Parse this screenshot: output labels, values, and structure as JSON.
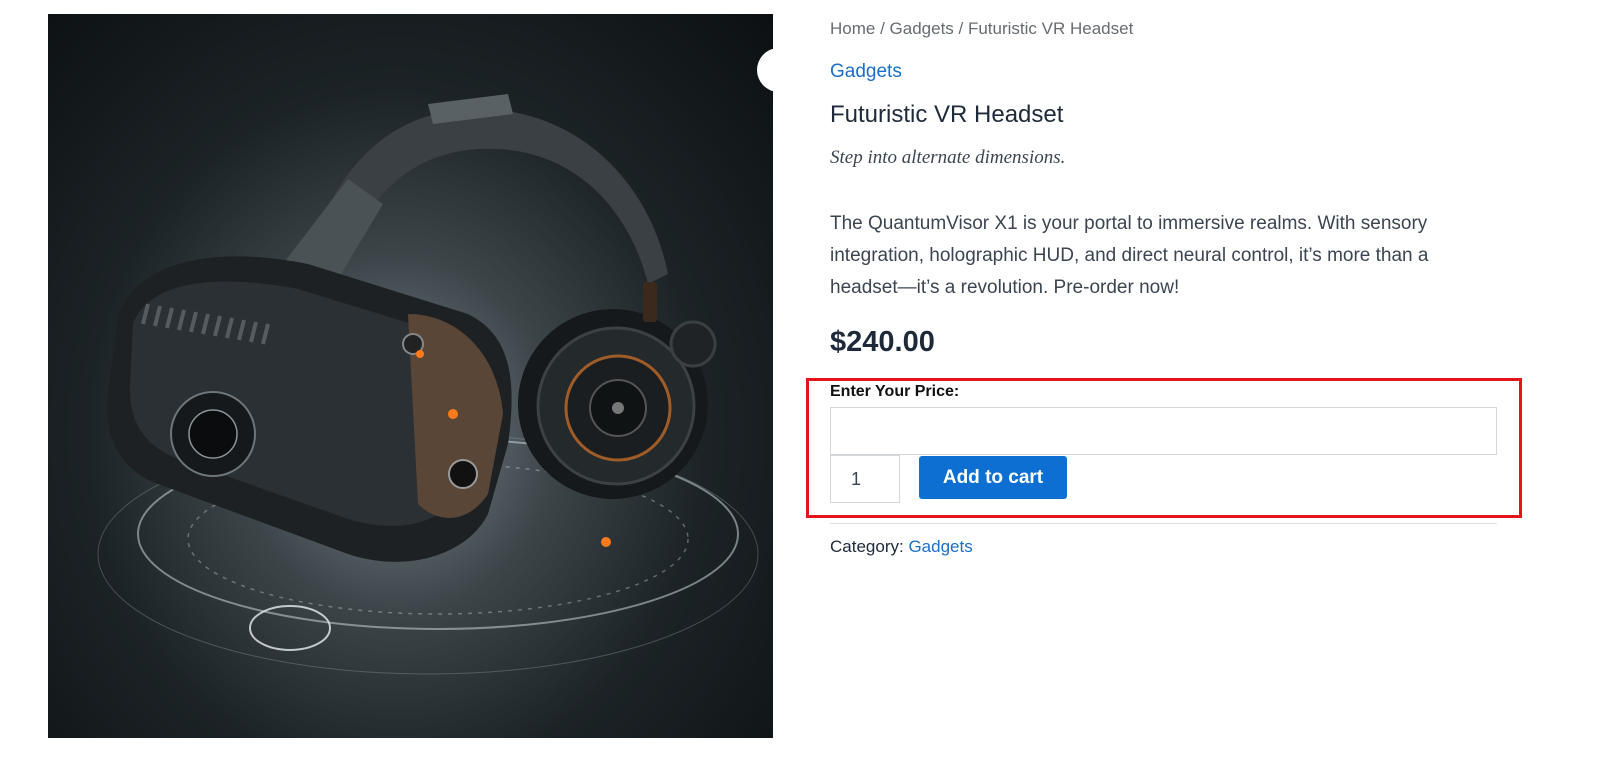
{
  "breadcrumb": {
    "home": "Home",
    "sep1": " / ",
    "category": "Gadgets",
    "sep2": " / ",
    "current": "Futuristic VR Headset"
  },
  "product": {
    "category_link": "Gadgets",
    "title": "Futuristic VR Headset",
    "tagline": "Step into alternate dimensions.",
    "description": "The QuantumVisor X1 is your portal to immersive realms. With sensory integration, holographic HUD, and direct neural control, it’s more than a headset—it’s a revolution. Pre-order now!",
    "price": "$240.00"
  },
  "form": {
    "price_label": "Enter Your Price:",
    "price_value": "",
    "quantity": "1",
    "add_to_cart_label": "Add to cart"
  },
  "meta": {
    "category_label": "Category:",
    "category_value": "Gadgets"
  },
  "icons": {
    "zoom": "magnifier-icon"
  },
  "colors": {
    "link": "#1a6fc9",
    "button": "#0e6fd2",
    "highlight": "#e5141b"
  }
}
